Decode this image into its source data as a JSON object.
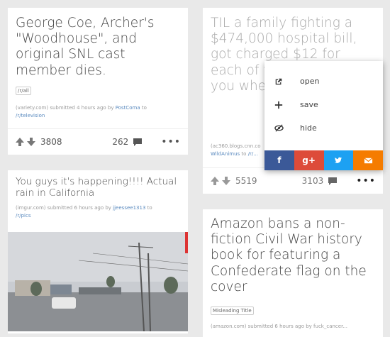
{
  "cards": [
    {
      "title": "George Coe, Archer's \"Woodhouse\", and original SNL cast member dies.",
      "tag": "/r/all",
      "domain": "(variety.com)",
      "submitted": "submitted 4 hours ago by",
      "author": "PostComa",
      "to": "to",
      "subreddit": "/r/television",
      "score": "3808",
      "comments": "262"
    },
    {
      "title": "TIL a family fighting a $474,000 hospital bill, got charged $12 for each of their paper cups you when administ",
      "domain": "(ac360.blogs.cnn.co",
      "author": "WildAnimus",
      "to": "to",
      "subreddit": "/r/...",
      "score": "5519",
      "comments": "3103"
    },
    {
      "title": "You guys it's happening!!!! Actual rain in California",
      "domain": "(imgur.com)",
      "submitted": "submitted 6 hours ago by",
      "author": "jjeessee1313",
      "to": "to",
      "subreddit": "/r/pics"
    },
    {
      "title": "Amazon bans a non-fiction Civil War history book for featuring a Confederate flag on the cover",
      "tag": "Misleading Title",
      "meta_partial": "(amazon.com) submitted 6 hours ago by fuck_cancer..."
    }
  ],
  "menu": {
    "items": [
      {
        "label": "open",
        "icon": "external-link-icon"
      },
      {
        "label": "save",
        "icon": "plus-icon"
      },
      {
        "label": "hide",
        "icon": "eye-slash-icon"
      }
    ],
    "share": [
      {
        "label": "f",
        "icon": "facebook-icon",
        "color": "#3b5998"
      },
      {
        "label": "g+",
        "icon": "google-plus-icon",
        "color": "#dd4b39"
      },
      {
        "label": "",
        "icon": "twitter-icon",
        "color": "#1da1f2"
      },
      {
        "label": "",
        "icon": "email-icon",
        "color": "#f57c00"
      }
    ]
  },
  "more_label": "•••"
}
